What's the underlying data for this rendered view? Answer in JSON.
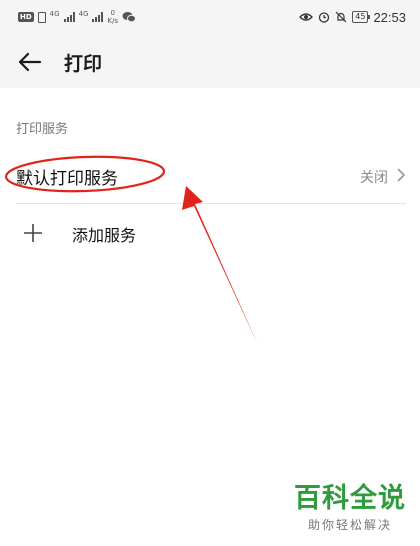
{
  "status_bar": {
    "hd": "HD",
    "net1": "4G",
    "net2": "4G",
    "speed_value": "0",
    "speed_unit": "K/s",
    "battery": "45",
    "time": "22:53"
  },
  "app_bar": {
    "title": "打印"
  },
  "section": {
    "header": "打印服务"
  },
  "rows": {
    "default_print": {
      "label": "默认打印服务",
      "value": "关闭"
    },
    "add_service": {
      "label": "添加服务"
    }
  },
  "watermark": {
    "logo": "百科全说",
    "tagline": "助你轻松解决"
  },
  "colors": {
    "annotation": "#e0241b",
    "watermark": "#2e9b3c"
  }
}
